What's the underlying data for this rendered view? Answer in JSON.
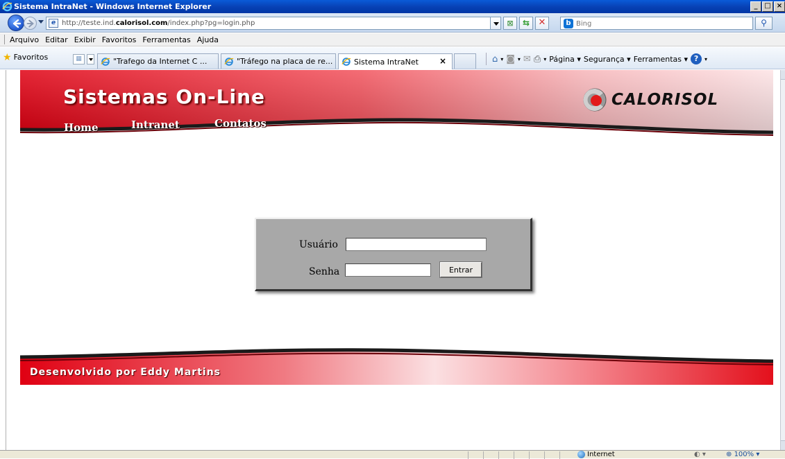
{
  "window": {
    "title": "Sistema IntraNet - Windows Internet Explorer",
    "buttons": [
      "_",
      "□",
      "×"
    ]
  },
  "addressbar": {
    "url_prefix": "http://teste.ind.",
    "url_domain": "calorisol.com",
    "url_suffix": "/index.php?pg=login.php",
    "search_placeholder": "Bing",
    "icons": [
      "back-arrow-icon",
      "forward-arrow-icon",
      "page-icon",
      "compatibility-icon",
      "refresh-icon",
      "stop-icon",
      "bing-icon",
      "search-icon"
    ]
  },
  "menubar": {
    "items": [
      "Arquivo",
      "Editar",
      "Exibir",
      "Favoritos",
      "Ferramentas",
      "Ajuda"
    ]
  },
  "favbar": {
    "favorites_label": "Favoritos",
    "tabs": [
      {
        "label": "\"Trafego da Internet C ..."
      },
      {
        "label": "\"Tráfego na placa de re..."
      },
      {
        "label": "Sistema IntraNet",
        "active": true
      }
    ],
    "commands": {
      "pagina": "Página",
      "seguranca": "Segurança",
      "ferramentas": "Ferramentas"
    }
  },
  "page": {
    "banner_title": "Sistemas On-Line",
    "logo_text": "CALORISOL",
    "nav": [
      "Home",
      "Intranet",
      "Contatos"
    ],
    "login": {
      "user_label": "Usuário",
      "pass_label": "Senha",
      "user_value": "",
      "pass_value": "",
      "submit_label": "Entrar"
    },
    "footer_text": "Desenvolvido por Eddy Martins"
  },
  "statusbar": {
    "zone": "Internet",
    "zoom": "100%"
  },
  "colors": {
    "banner_red": "#e8101e",
    "login_box": "#a8a8a8",
    "titlebar_blue": "#0842b6"
  }
}
